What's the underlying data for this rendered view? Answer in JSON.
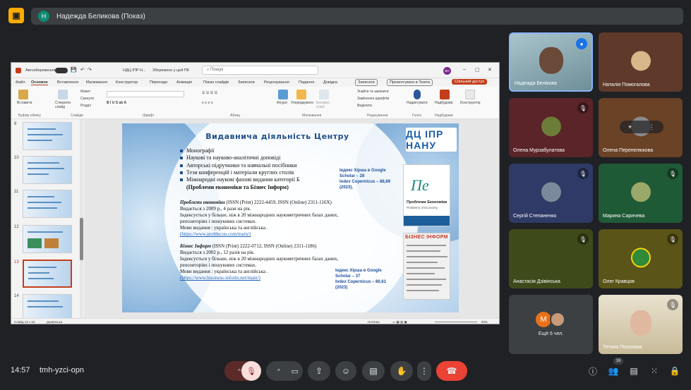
{
  "topbar": {
    "presenter_initial": "Н",
    "presenter_label": "Надежда Беликова (Показ)"
  },
  "ppt": {
    "autosave_label": "Автозбереження",
    "doc_name": "НДЦ ІПР Н...",
    "saved_status": "Збережено у цей ПК",
    "search_placeholder": "Пошук",
    "user_initials": "ВН",
    "menu": [
      "Файл",
      "Основне",
      "Вставлення",
      "Малювання",
      "Конструктор",
      "Переходи",
      "Анімація",
      "Показ слайдів",
      "Записати",
      "Рецензування",
      "Подання",
      "Довідка"
    ],
    "record_btn": "Записати",
    "present_teams_btn": "Презентувати в Teams",
    "share_btn": "Спільний доступ",
    "ribbon": {
      "paste": "Вставити",
      "new_slide": "Створити слайд",
      "layout": "Макет",
      "reset": "Скинути",
      "section": "Розділ",
      "shapes": "Фігури",
      "arrange": "Упорядкувати",
      "quick_styles": "Експрес-стилі",
      "find": "Знайти та замінити",
      "replace_fonts": "Замінення шрифтів",
      "select": "Виділити",
      "dictate": "Надиктувати",
      "addins": "Надбудови",
      "designer": "Конструктор",
      "groups": [
        "Буфер обміну",
        "Слайди",
        "Шрифт",
        "Абзац",
        "Малювання",
        "Редагування",
        "Голос",
        "Надбудови"
      ]
    },
    "thumbnails": [
      {
        "num": "9"
      },
      {
        "num": "10"
      },
      {
        "num": "11"
      },
      {
        "num": "12"
      },
      {
        "num": "13",
        "selected": true
      },
      {
        "num": "14"
      }
    ],
    "status": {
      "slide_info": "Слайд 13 з 16",
      "language": "українська",
      "notes": "Нотатки",
      "zoom": "83%"
    }
  },
  "slide": {
    "title": "Видавнича діяльність Центру",
    "logo": "ДЦ ІПР НАНУ",
    "bullets": [
      "Монографії",
      "Наукові та науково-аналітичні доповіді",
      "Авторські підручники та навчальні посібники",
      "Тези конференцій і матеріали круглих столів",
      "Міжнародні наукові фахові видання категорії Б"
    ],
    "bullets_extra": "(Проблеми економіки та Бізнес Інформ)",
    "journal1": {
      "name": "Проблеми економіки",
      "issn": " (ISSN (Print) 2222-4459, ISSN (Online) 2311-116X)",
      "l1": "Видається з 2009 р., 4 рази на рік.",
      "l2": "Індексується у більше, ніж в 20 міжнародних наукометричних базах даних,",
      "l3": "репозиторіях і пошукових системах.",
      "l4": "Мови видання : українська та англійська .",
      "url": "(https://www.problecon.com/main/)"
    },
    "journal2": {
      "name": "Бізнес Інформ",
      "issn": " (ISSN (Print) 2222-0712, ISSN (Online) 2311-1186)",
      "l1": "Видається з 2002 р., 12 разів на рік.",
      "l2": "Індексується у більше, ніж в 20 міжнародних наукометричних базах даних,",
      "l3": "репозиторіях і пошукових системах.",
      "l4": "Мови видання : українська та англійська .",
      "url": "(https://www.business-inform.net/main/)"
    },
    "index1": [
      "Індекс Хірша в Google",
      "Scholar – 28",
      "Index Copernicus – 88,89",
      "(2023),"
    ],
    "index2": [
      "Індекс Хірша в Google",
      "Scholar – 37",
      "Index Copernicus – 80,61",
      "(2023)"
    ],
    "cover1_title": "Проблеми Економіки",
    "cover1_sub": "Problems of Economy",
    "cover2_title": "БІЗНЕС ІНФОРМ"
  },
  "participants": [
    {
      "name": "Надежда Белікова",
      "speaking": true
    },
    {
      "name": "Наталія Помогалова"
    },
    {
      "name": "Олена Мурзабулатова",
      "muted": true
    },
    {
      "name": "Олена Перепелюкова"
    },
    {
      "name": "Сергій Степаненко",
      "muted": true
    },
    {
      "name": "Марина Саричева",
      "muted": true
    },
    {
      "name": "Анастасія Дзівінська",
      "muted": true
    },
    {
      "name": "Олег Кравцов",
      "muted": true
    },
    {
      "name": "Ещё 6 чел.",
      "initial": "М"
    },
    {
      "name": "Тетяна Полозова",
      "muted": true
    }
  ],
  "bottom": {
    "time": "14:57",
    "meeting_code": "tmh-yzci-opn",
    "people_count": "16"
  },
  "colors": {
    "background": "#202124",
    "end_call": "#ea4335",
    "mic_off": "#f28b82",
    "accent_yellow": "#f9ab00"
  }
}
